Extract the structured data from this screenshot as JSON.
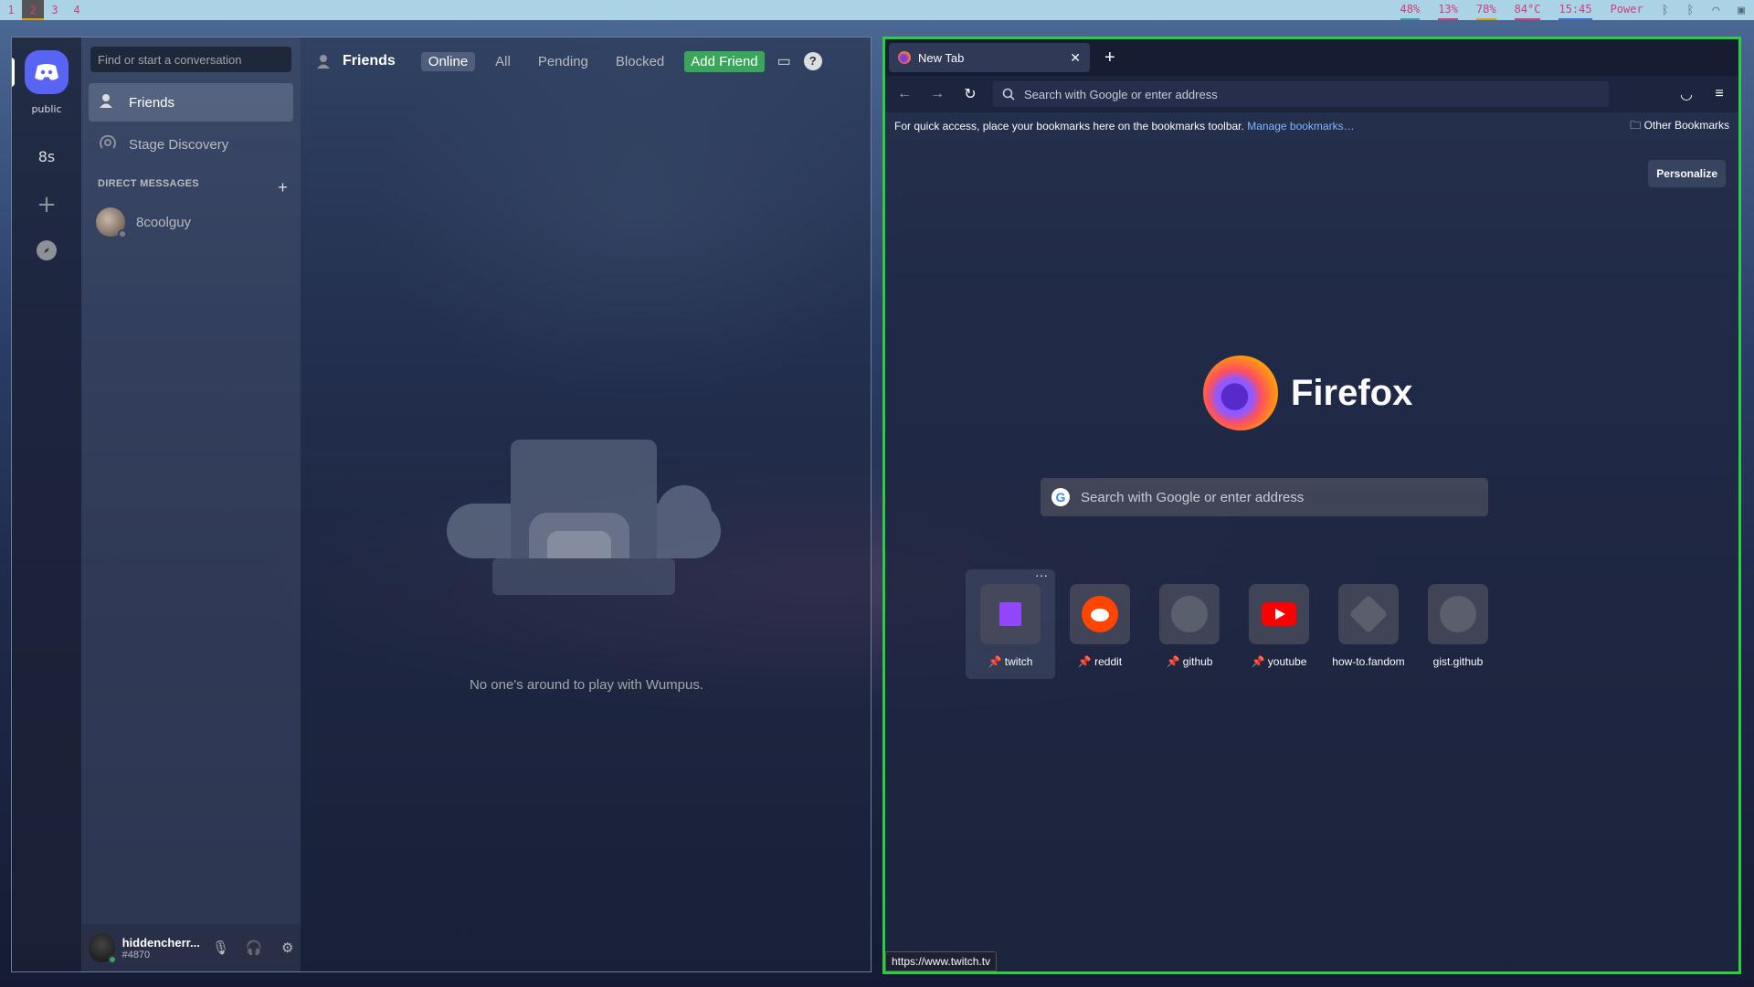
{
  "topbar": {
    "workspaces": [
      "1",
      "2",
      "3",
      "4"
    ],
    "active_workspace": "2",
    "cpu": "48%",
    "mem": "13%",
    "disk": "78%",
    "temp": "84°C",
    "time": "15:45",
    "power": "Power"
  },
  "discord": {
    "guilds": {
      "home_label": "public",
      "server_8s": "8s"
    },
    "search_placeholder": "Find or start a conversation",
    "nav": {
      "friends": "Friends",
      "stage_discovery": "Stage Discovery"
    },
    "dm_header": "DIRECT MESSAGES",
    "dms": [
      {
        "name": "8coolguy"
      }
    ],
    "user": {
      "name": "hiddencherr...",
      "tag": "#4870"
    },
    "header": {
      "title": "Friends",
      "tabs": [
        "Online",
        "All",
        "Pending",
        "Blocked"
      ],
      "active_tab": "Online",
      "add_friend": "Add Friend"
    },
    "empty_text": "No one's around to play with Wumpus."
  },
  "firefox": {
    "tab_title": "New Tab",
    "url_placeholder": "Search with Google or enter address",
    "bookmarks_text": "For quick access, place your bookmarks here on the bookmarks toolbar.",
    "bookmarks_link": "Manage bookmarks…",
    "other_bookmarks": "Other Bookmarks",
    "personalize": "Personalize",
    "brand": "Firefox",
    "search_placeholder": "Search with Google or enter address",
    "tiles": [
      {
        "label": "twitch",
        "pinned": true
      },
      {
        "label": "reddit",
        "pinned": true
      },
      {
        "label": "github",
        "pinned": true
      },
      {
        "label": "youtube",
        "pinned": true
      },
      {
        "label": "how-to.fandom",
        "pinned": false
      },
      {
        "label": "gist.github",
        "pinned": false
      }
    ],
    "status_url": "https://www.twitch.tv"
  },
  "colors": {
    "discord_blurple": "#5865f2",
    "discord_green": "#3ba55c",
    "firefox_border": "#2ecc40",
    "topbar_bg": "#aad3e6",
    "topbar_text": "#d23d7a"
  }
}
